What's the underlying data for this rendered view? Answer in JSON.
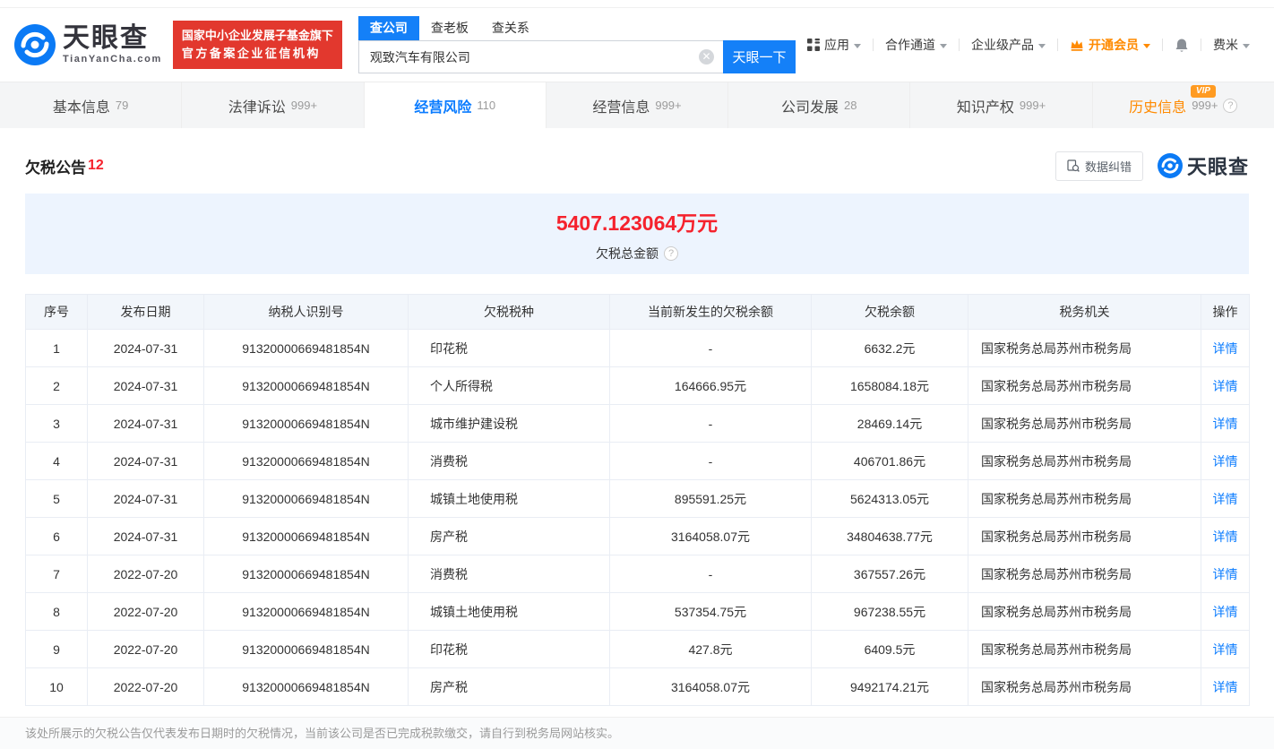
{
  "colors": {
    "brand_blue": "#1480f8",
    "active_tab_blue": "#0b7cff",
    "alert_red": "#f5222d",
    "badge_red": "#e2382e",
    "vip_orange": "#ff8a00",
    "summary_bg": "#edf4fe",
    "table_header_bg": "#f2f6fb"
  },
  "header": {
    "logo_title": "天眼查",
    "logo_domain": "TianYanCha.com",
    "badge_line1": "国家中小企业发展子基金旗下",
    "badge_line2": "官方备案企业征信机构",
    "search": {
      "tabs": [
        {
          "label": "查公司",
          "active": true
        },
        {
          "label": "查老板",
          "active": false
        },
        {
          "label": "查关系",
          "active": false
        }
      ],
      "input_value": "观致汽车有限公司",
      "button_label": "天眼一下"
    },
    "nav": {
      "apps": "应用",
      "partner": "合作通道",
      "enterprise": "企业级产品",
      "vip": "开通会员",
      "user": "费米"
    }
  },
  "tabs": [
    {
      "label": "基本信息",
      "count": "79",
      "active": false
    },
    {
      "label": "法律诉讼",
      "count": "999+",
      "active": false
    },
    {
      "label": "经营风险",
      "count": "110",
      "active": true
    },
    {
      "label": "经营信息",
      "count": "999+",
      "active": false
    },
    {
      "label": "公司发展",
      "count": "28",
      "active": false
    },
    {
      "label": "知识产权",
      "count": "999+",
      "active": false
    },
    {
      "label": "历史信息",
      "count": "999+",
      "active": false,
      "vip_badge": "VIP",
      "help": true
    }
  ],
  "section": {
    "title": "欠税公告",
    "count": "12",
    "correction_label": "数据纠错",
    "brand": "天眼查"
  },
  "summary": {
    "amount": "5407.123064万元",
    "label": "欠税总金额"
  },
  "table": {
    "headers": [
      "序号",
      "发布日期",
      "纳税人识别号",
      "欠税税种",
      "当前新发生的欠税余额",
      "欠税余额",
      "税务机关",
      "操作"
    ],
    "action_label": "详情",
    "rows": [
      [
        "1",
        "2024-07-31",
        "91320000669481854N",
        "印花税",
        "-",
        "6632.2元",
        "国家税务总局苏州市税务局"
      ],
      [
        "2",
        "2024-07-31",
        "91320000669481854N",
        "个人所得税",
        "164666.95元",
        "1658084.18元",
        "国家税务总局苏州市税务局"
      ],
      [
        "3",
        "2024-07-31",
        "91320000669481854N",
        "城市维护建设税",
        "-",
        "28469.14元",
        "国家税务总局苏州市税务局"
      ],
      [
        "4",
        "2024-07-31",
        "91320000669481854N",
        "消费税",
        "-",
        "406701.86元",
        "国家税务总局苏州市税务局"
      ],
      [
        "5",
        "2024-07-31",
        "91320000669481854N",
        "城镇土地使用税",
        "895591.25元",
        "5624313.05元",
        "国家税务总局苏州市税务局"
      ],
      [
        "6",
        "2024-07-31",
        "91320000669481854N",
        "房产税",
        "3164058.07元",
        "34804638.77元",
        "国家税务总局苏州市税务局"
      ],
      [
        "7",
        "2022-07-20",
        "91320000669481854N",
        "消费税",
        "-",
        "367557.26元",
        "国家税务总局苏州市税务局"
      ],
      [
        "8",
        "2022-07-20",
        "91320000669481854N",
        "城镇土地使用税",
        "537354.75元",
        "967238.55元",
        "国家税务总局苏州市税务局"
      ],
      [
        "9",
        "2022-07-20",
        "91320000669481854N",
        "印花税",
        "427.8元",
        "6409.5元",
        "国家税务总局苏州市税务局"
      ],
      [
        "10",
        "2022-07-20",
        "91320000669481854N",
        "房产税",
        "3164058.07元",
        "9492174.21元",
        "国家税务总局苏州市税务局"
      ]
    ]
  },
  "footer_note": "该处所展示的欠税公告仅代表发布日期时的欠税情况，当前该公司是否已完成税款缴交，请自行到税务局网站核实。"
}
